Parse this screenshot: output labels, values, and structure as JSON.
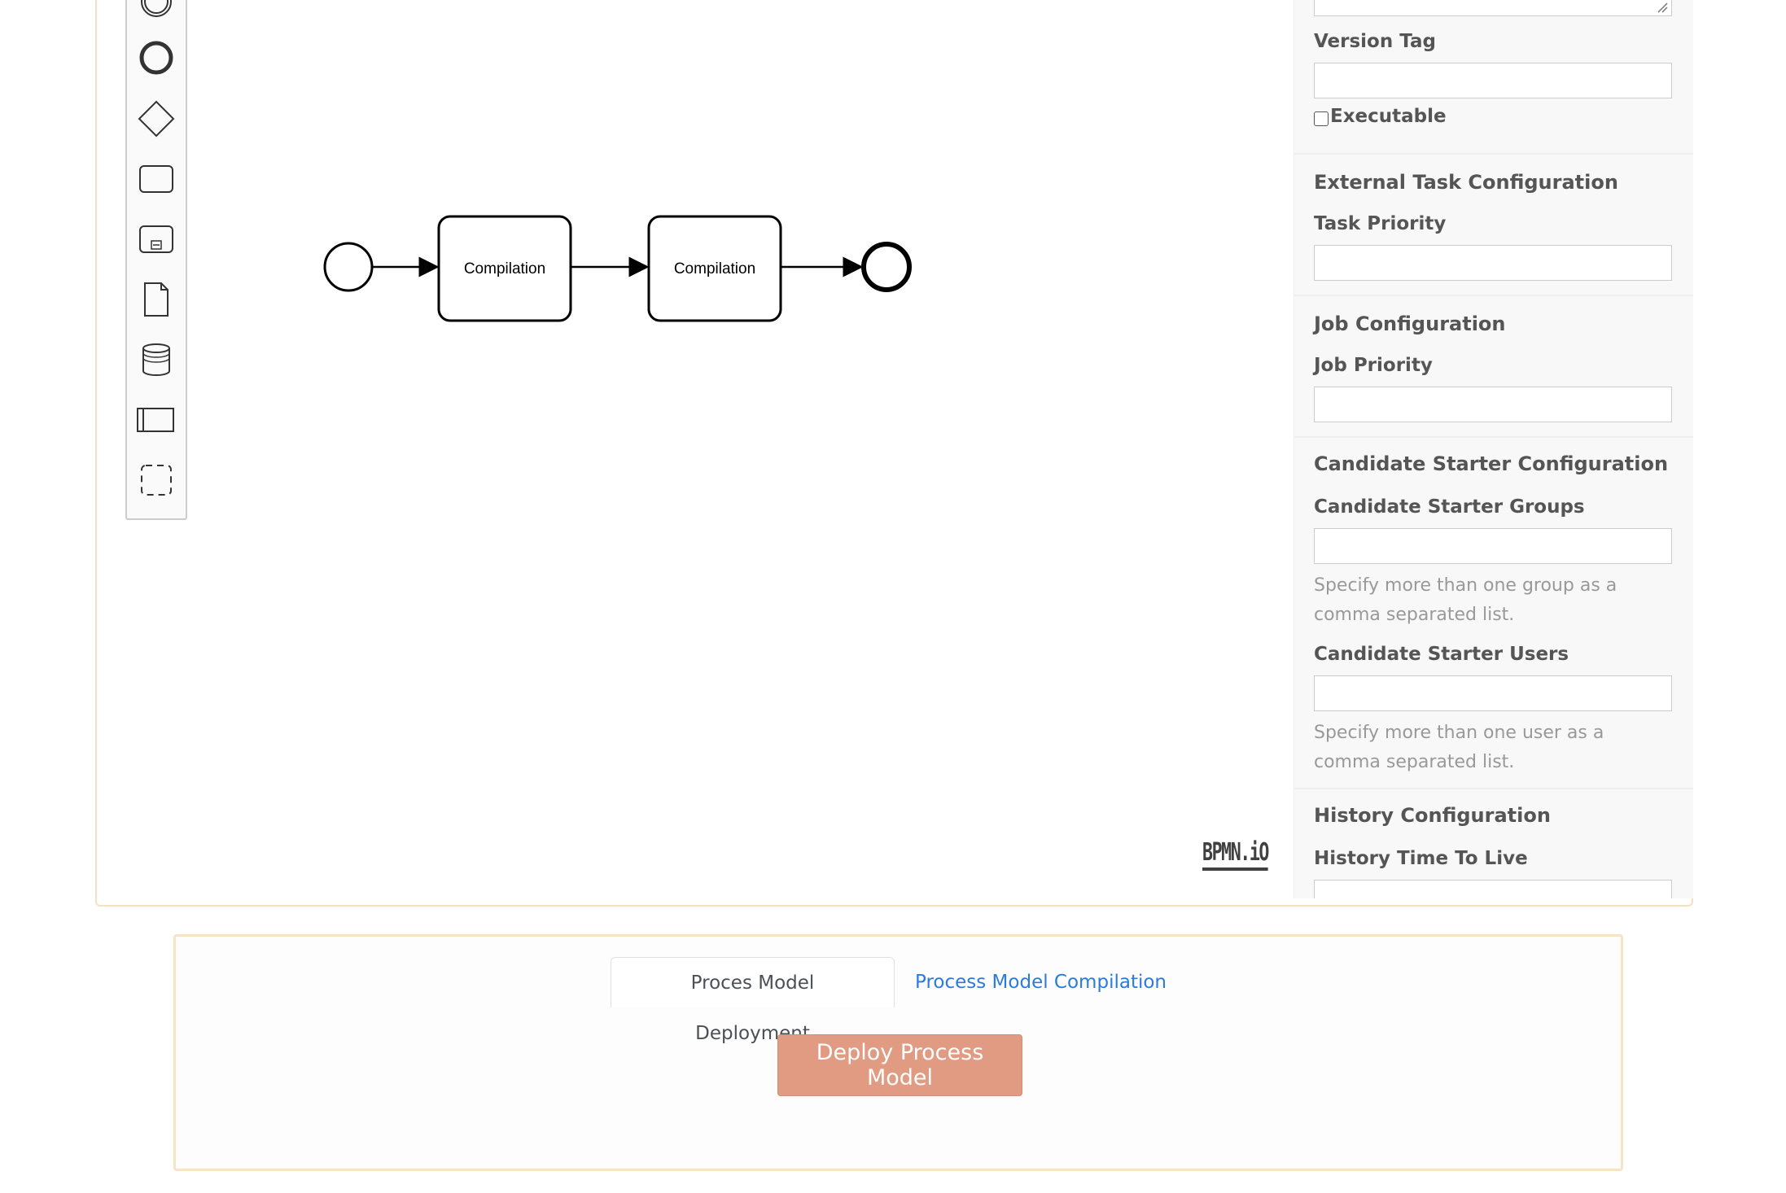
{
  "diagram": {
    "task1_label": "Compilation",
    "task2_label": "Compilation"
  },
  "palette": {
    "tools": [
      "start-event",
      "end-event",
      "gateway",
      "task",
      "subprocess",
      "data-object",
      "data-store",
      "pool",
      "group"
    ]
  },
  "logo": "BPMN.iO",
  "properties": {
    "version_tag_label": "Version Tag",
    "executable_label": "Executable",
    "external_task_title": "External Task Configuration",
    "task_priority_label": "Task Priority",
    "job_config_title": "Job Configuration",
    "job_priority_label": "Job Priority",
    "candidate_title": "Candidate Starter Configuration",
    "candidate_groups_label": "Candidate Starter Groups",
    "candidate_groups_hint": "Specify more than one group as a comma separated list.",
    "candidate_users_label": "Candidate Starter Users",
    "candidate_users_hint": "Specify more than one user as a comma separated list.",
    "history_title": "History Configuration",
    "history_ttl_label": "History Time To Live"
  },
  "tabs": {
    "deployment": "Proces Model Deployment",
    "compilation": "Process Model Compilation"
  },
  "deploy_button": "Deploy Process Model"
}
